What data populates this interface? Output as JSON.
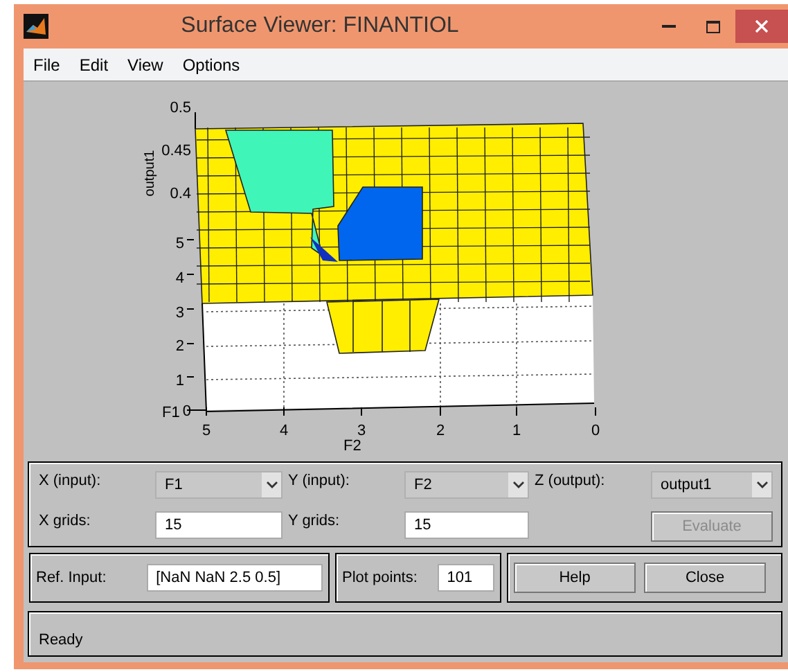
{
  "window": {
    "title": "Surface Viewer: FINANTIOL"
  },
  "menu": [
    "File",
    "Edit",
    "View",
    "Options"
  ],
  "plot": {
    "zlabel": "output1",
    "zticks": [
      "0.5",
      "0.45",
      "0.4"
    ],
    "xlabel": "F1",
    "xticks": [
      "5",
      "4",
      "3",
      "2",
      "1",
      "0"
    ],
    "ylabel": "F2",
    "yticks": [
      "5",
      "4",
      "3",
      "2",
      "1",
      "0"
    ]
  },
  "selectors": [
    {
      "label": "X (input):",
      "value": "F1"
    },
    {
      "label": "Y (input):",
      "value": "F2"
    },
    {
      "label": "Z (output):",
      "value": "output1"
    }
  ],
  "grids": [
    {
      "label": "X grids:",
      "value": "15"
    },
    {
      "label": "Y grids:",
      "value": "15"
    }
  ],
  "evaluate": {
    "label": "Evaluate",
    "disabled": true
  },
  "ref_input": {
    "label": "Ref. Input:",
    "value": "[NaN NaN 2.5 0.5]"
  },
  "plot_points": {
    "label": "Plot points:",
    "value": "101"
  },
  "buttons": [
    "Help",
    "Close"
  ],
  "status": "Ready"
}
